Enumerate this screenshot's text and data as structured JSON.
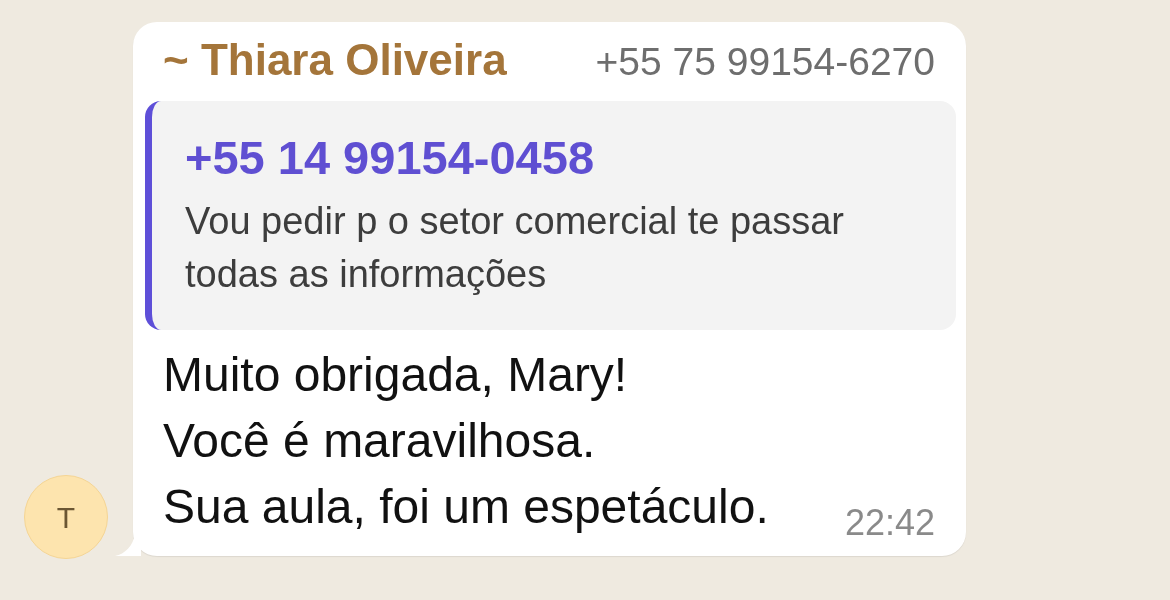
{
  "chat": {
    "avatar": {
      "initial": "T"
    },
    "message": {
      "sender_name": "~ Thiara Oliveira",
      "sender_phone": "+55 75 99154-6270",
      "quoted": {
        "author": "+55 14 99154-0458",
        "text": "Vou pedir p o setor comercial te passar todas as informações"
      },
      "text": "Muito obrigada, Mary!\nVocê é maravilhosa.\nSua aula, foi um espetáculo.",
      "time": "22:42"
    }
  }
}
